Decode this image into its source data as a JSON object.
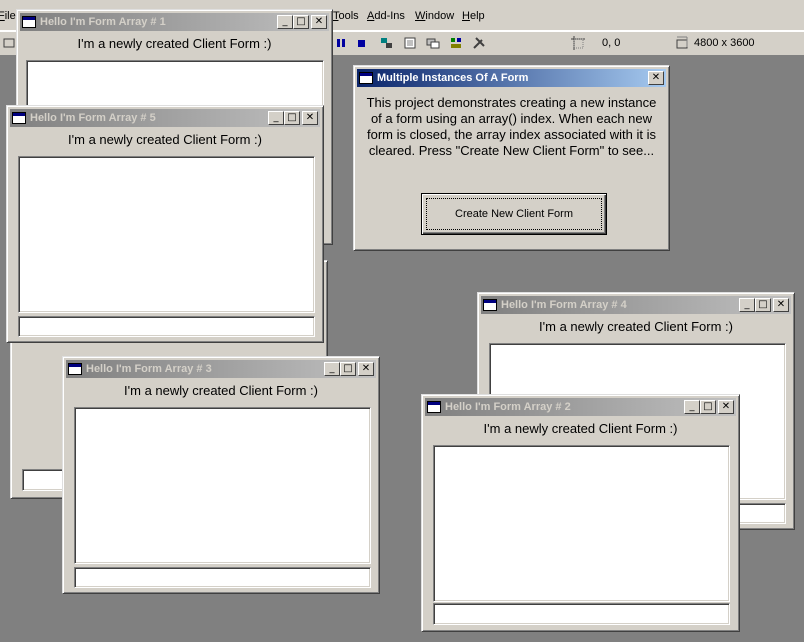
{
  "menu": {
    "items": [
      "File",
      "Tools",
      "Add-Ins",
      "Window",
      "Help"
    ]
  },
  "toolbar": {
    "position": "0, 0",
    "size": "4800 x 3600"
  },
  "client_forms": [
    {
      "title": "Hello I'm Form Array # 1",
      "label": "I'm a newly created Client Form :)"
    },
    {
      "title": "Hello I'm Form Array # 5",
      "label": "I'm a newly created Client Form :)"
    },
    {
      "title": "Hello I'm Form Array # 3",
      "label": "I'm a newly created Client Form :)"
    },
    {
      "title": "Hello I'm Form Array # 4",
      "label": "I'm a newly created Client Form :)"
    },
    {
      "title": "Hello I'm Form Array # 2",
      "label": "I'm a newly created Client Form :)"
    }
  ],
  "main_form": {
    "title": "Multiple Instances Of A Form",
    "description": "This project demonstrates creating a new instance of a form using an array() index. When each new form is closed, the array index associated with it is cleared. Press \"Create New Client Form\" to see...",
    "button_label": "Create New Client Form"
  },
  "caption_buttons": {
    "minimize": "_",
    "maximize": "□",
    "close": "✕"
  },
  "colors": {
    "desktop": "#808080",
    "active_title_start": "#0a246a",
    "active_title_end": "#a6caf0",
    "inactive_title_start": "#808080",
    "face": "#d4d0c8"
  }
}
